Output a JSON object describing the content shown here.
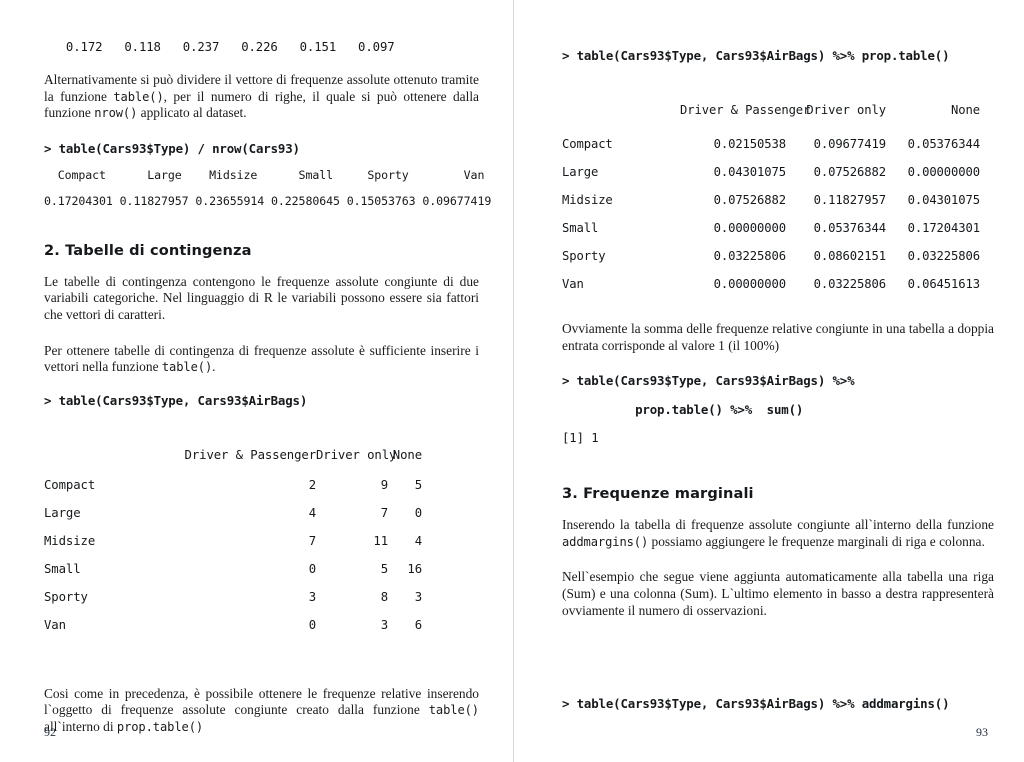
{
  "document": {
    "language": "it",
    "divider_color": "#d6d6d6"
  },
  "left_page": {
    "folio": "92",
    "rel_freq_short_output": "   0.172   0.118   0.237   0.226   0.151   0.097",
    "para_1": "Alternativamente si può dividere il vettore di frequenze assolute ottenuto tramite la funzione ",
    "para_1_code_a": "table()",
    "para_1_mid": ", per il numero di righe, il quale si può ottenere dalla funzione ",
    "para_1_code_b": "nrow()",
    "para_1_end": " applicato al dataset.",
    "code_1": "> table(Cars93$Type) / nrow(Cars93)",
    "freq_header": "  Compact      Large    Midsize      Small     Sporty        Van",
    "freq_values": "0.17204301 0.11827957 0.23655914 0.22580645 0.15053763 0.09677419",
    "heading_2": "2. Tabelle di contingenza",
    "para_2": "Le tabelle di contingenza contengono le frequenze assolute congiunte di due variabili categoriche. Nel linguaggio di R le variabili possono essere sia fattori che vettori di caratteri.",
    "para_3_start": "Per ottenere tabelle di contingenza di frequenze assolute è sufficiente inserire i vettori nella funzione ",
    "para_3_code": "table()",
    "para_3_end": ".",
    "code_2": "> table(Cars93$Type, Cars93$AirBags)",
    "counts_table": {
      "columns": [
        "Driver & Passenger",
        "Driver only",
        "None"
      ],
      "rows": [
        {
          "label": "Compact",
          "values": [
            "2",
            "9",
            "5"
          ]
        },
        {
          "label": "Large",
          "values": [
            "4",
            "7",
            "0"
          ]
        },
        {
          "label": "Midsize",
          "values": [
            "7",
            "11",
            "4"
          ]
        },
        {
          "label": "Small",
          "values": [
            "0",
            "5",
            "16"
          ]
        },
        {
          "label": "Sporty",
          "values": [
            "3",
            "8",
            "3"
          ]
        },
        {
          "label": "Van",
          "values": [
            "0",
            "3",
            "6"
          ]
        }
      ]
    },
    "para_4_start": "Cosi come in precedenza, è possibile ottenere le frequenze relative inserendo l`oggetto di frequenze assolute congiunte creato dalla funzione ",
    "para_4_code_a": "table()",
    "para_4_mid": " all`interno di ",
    "para_4_code_b": "prop.table()"
  },
  "right_page": {
    "folio": "93",
    "code_1": "> table(Cars93$Type, Cars93$AirBags) %>% prop.table()",
    "props_table": {
      "columns": [
        "Driver & Passenger",
        "Driver only",
        "None"
      ],
      "rows": [
        {
          "label": "Compact",
          "values": [
            "0.02150538",
            "0.09677419",
            "0.05376344"
          ]
        },
        {
          "label": "Large",
          "values": [
            "0.04301075",
            "0.07526882",
            "0.00000000"
          ]
        },
        {
          "label": "Midsize",
          "values": [
            "0.07526882",
            "0.11827957",
            "0.04301075"
          ]
        },
        {
          "label": "Small",
          "values": [
            "0.00000000",
            "0.05376344",
            "0.17204301"
          ]
        },
        {
          "label": "Sporty",
          "values": [
            "0.03225806",
            "0.08602151",
            "0.03225806"
          ]
        },
        {
          "label": "Van",
          "values": [
            "0.00000000",
            "0.03225806",
            "0.06451613"
          ]
        }
      ]
    },
    "para_1": "Ovviamente la somma delle frequenze relative congiunte in una tabella a doppia entrata corrisponde al valore 1 (il 100%)",
    "code_2_line1": "> table(Cars93$Type, Cars93$AirBags) %>%",
    "code_2_line2": "          prop.table() %>%  sum()",
    "code_2_result": "[1] 1",
    "heading_3": "3. Frequenze marginali",
    "para_2_start": "Inserendo la tabella di frequenze assolute congiunte all`interno della funzione ",
    "para_2_code": "addmargins()",
    "para_2_end": " possiamo aggiungere le frequenze marginali di riga e colonna.",
    "para_3": "Nell`esempio che segue viene aggiunta automaticamente alla tabella una riga (Sum) e una colonna (Sum). L`ultimo elemento in basso a destra rappresenterà ovviamente il numero di osservazioni.",
    "code_3": "> table(Cars93$Type, Cars93$AirBags) %>% addmargins()"
  }
}
